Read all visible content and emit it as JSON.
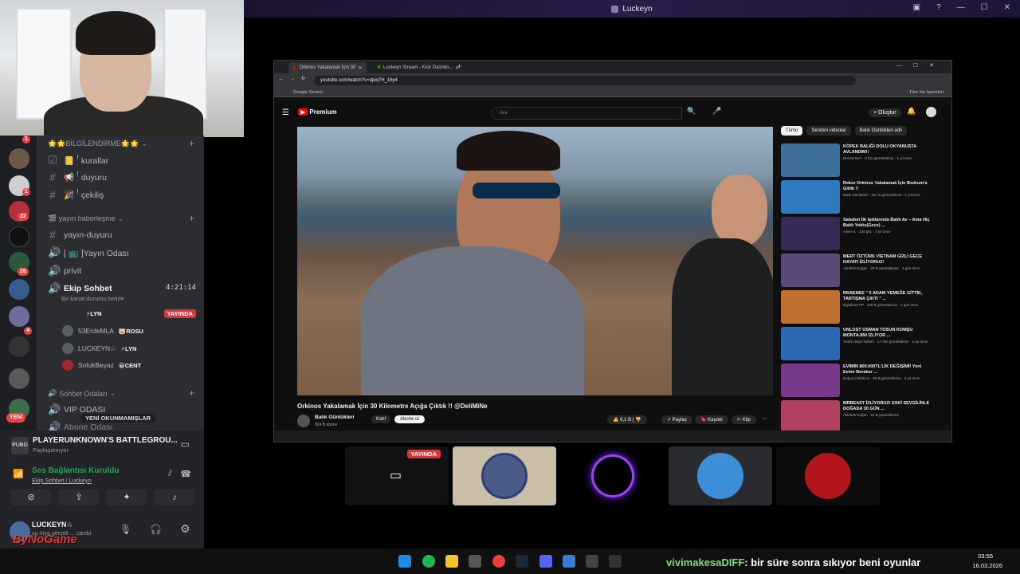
{
  "window": {
    "title": "Luckeyn"
  },
  "channels": {
    "category_info": "🌟🌟BİLGİLENDİRME🌟🌟",
    "items": [
      {
        "icon": "checkbox-icon",
        "label": "📒 ꜝ kurallar"
      },
      {
        "icon": "hash-icon",
        "label": "📢 ꜝ duyuru"
      },
      {
        "icon": "hash-icon",
        "label": "🎉 ꜝ çekiliş"
      }
    ],
    "category_stream": "🎬 yayın haberleşme",
    "stream_items": [
      {
        "label": "yayın-duyuru"
      },
      {
        "label": "[ 📺 ]Yayın Odası"
      },
      {
        "label": "privit"
      }
    ],
    "voice_channel": {
      "name": "Ekip Sohbet",
      "time": "4:21:14",
      "status": "Bir kanal durumu belirle",
      "live_badge": "YAYINDA"
    },
    "voice_users": [
      {
        "name": "",
        "tag": "⚡LYN"
      },
      {
        "name": "53ErdeMLA",
        "tag": "🐷ROSU"
      },
      {
        "name": "LUCKEYN☆",
        "tag": "⚡LYN"
      },
      {
        "name": "SolukBeyaz",
        "tag": "😀CENT"
      }
    ],
    "category_chat": "Sohbet Odaları",
    "unread_badge": "YENİ OKUNMAMIŞLAR",
    "vip": "VIP ODASI",
    "abone": "Abone Odası",
    "new_label": "YENİ"
  },
  "server_badges": [
    "1",
    "1",
    "22",
    "26",
    "4"
  ],
  "activity": {
    "game": "PLAYERUNKNOWN'S BATTLEGROU...",
    "sub": "Paylaşılmıyor"
  },
  "voice_panel": {
    "status": "Ses Bağlantısı Kuruldu",
    "channel": "Ekip Sohbet / Luckeyn"
  },
  "userbar": {
    "name": "LUCKEYN☆",
    "status": "şu rüya gerçek ... cambi",
    "watermark": "ByNoGame"
  },
  "browser": {
    "tabs": [
      "Orkinos Yakalamak İçin 30",
      "Luckeyn Stream - Kick Dashbo..."
    ],
    "url": "youtube.com/watch?v=dpiq7H_16y4",
    "bookmark": "Google Gemini",
    "bookmark_right": "Tüm Yer İşaretleri",
    "yt_logo": "Premium",
    "yt_search_placeholder": "Ara",
    "create": "Oluştur",
    "video_title": "Orkinos Yakalamak İçin 30 Kilometre Açığa Çıktık !! @DeliMiNe",
    "channel": "Balık Günlükleri",
    "subs": "924 B abone",
    "join": "Katıl",
    "subscribe": "Abone ol",
    "likes": "6,1 B",
    "share": "Paylaş",
    "save": "Kaydet",
    "clip": "Klip",
    "chips": [
      "Tümü",
      "Seriden videolar",
      "Balık Günlükleri adlı"
    ],
    "recs": [
      {
        "title": "KÖPEK BALIĞI DOLU OKYANUSTA AVLANDIM!!",
        "meta": "Deli Mi Ne? · 3 Mn görüntüleme · 1 yıl önce"
      },
      {
        "title": "Rekor Orkinos Yakalamak İçin Bodrum'a Gittik !!",
        "meta": "Balık Günlükleri · 267 B görüntüleme · 1 yıl önce"
      },
      {
        "title": "Sabahın İlk Işıklarında Balık Av – Ama Hiç Balık Yoktu(Gece) ...",
        "meta": "Adem K · 234 gör. · 2 yıl önce"
      },
      {
        "title": "MERT ÖZTÜRK VİETNAM GİZLİ GECE HAYATI İZLİYORUZ!",
        "meta": "Alazbek Doğan · 29 B görüntüleme · 1 gün önce"
      },
      {
        "title": "RRAENEE \" 5 ADAM YEMEĞE GİTTİK, TARTIŞMA ÇIKTI \" ...",
        "meta": "Eightbom FP · 248 B görüntüleme · 2 gün önce"
      },
      {
        "title": "UNLOST OSMAN TOSUN KOMŞU MONTAJINI İZLİYOR ...",
        "meta": "Twitch Seyir Defteri · 1,7 Mn görüntüleme · 1 ay önce"
      },
      {
        "title": "EVİMİN 800.000TL'LİK DEĞİŞİMİ! Yeni Evimi Beraber ...",
        "meta": "Doğuş Cabakcor · 65 B görüntüleme · 5 yıl önce"
      },
      {
        "title": "MRBEAST İZLİYORUZ! ESKİ SEVGİLİNLE DOĞADA 30 GÜN ...",
        "meta": "Alazbek Doğan · 51 B görüntüleme"
      }
    ]
  },
  "tiles": {
    "live": "YAYINDA"
  },
  "taskbar": {
    "clock_time": "03:55",
    "clock_date": "16.03.2026"
  },
  "chat": {
    "user": "vivimakesaDIFF",
    "message": ": bir süre sonra sıkıyor beni oyunlar"
  }
}
